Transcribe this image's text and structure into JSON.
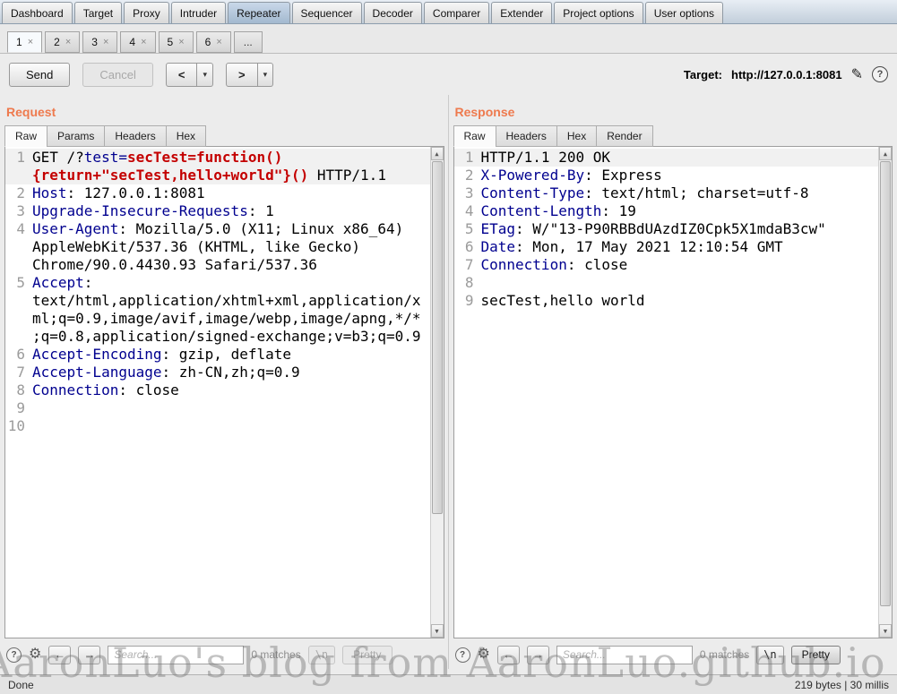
{
  "nav": {
    "tabs": [
      {
        "label": "Dashboard"
      },
      {
        "label": "Target"
      },
      {
        "label": "Proxy"
      },
      {
        "label": "Intruder"
      },
      {
        "label": "Repeater",
        "selected": true
      },
      {
        "label": "Sequencer"
      },
      {
        "label": "Decoder"
      },
      {
        "label": "Comparer"
      },
      {
        "label": "Extender"
      },
      {
        "label": "Project options"
      },
      {
        "label": "User options"
      }
    ]
  },
  "repeater_tabs": {
    "tabs": [
      {
        "label": "1",
        "selected": true
      },
      {
        "label": "2"
      },
      {
        "label": "3"
      },
      {
        "label": "4"
      },
      {
        "label": "5"
      },
      {
        "label": "6"
      }
    ],
    "overflow_label": "..."
  },
  "toolbar": {
    "send_label": "Send",
    "cancel_label": "Cancel",
    "back_label": "<",
    "forward_label": ">",
    "target_label": "Target:",
    "target_value": "http://127.0.0.1:8081"
  },
  "icons": {
    "help": "?",
    "edit": "✎",
    "gear": "⚙",
    "prev": "←",
    "next": "→",
    "up": "▲",
    "down": "▼",
    "close": "×",
    "dropdown": "▾"
  },
  "request_panel": {
    "title": "Request",
    "tabs": [
      {
        "label": "Raw",
        "selected": true
      },
      {
        "label": "Params"
      },
      {
        "label": "Headers"
      },
      {
        "label": "Hex"
      }
    ],
    "lines": [
      {
        "num": "1",
        "highlighted": true,
        "segments": [
          {
            "text": "GET /?",
            "type": "plain"
          },
          {
            "text": "test=",
            "type": "name"
          },
          {
            "text": "secTest=function(){return+\"secTest,hello+world\"}()",
            "type": "value"
          },
          {
            "text": " HTTP/1.1",
            "type": "plain"
          }
        ]
      },
      {
        "num": "2",
        "segments": [
          {
            "text": "Host",
            "type": "name"
          },
          {
            "text": ": 127.0.0.1:8081",
            "type": "plain"
          }
        ]
      },
      {
        "num": "3",
        "segments": [
          {
            "text": "Upgrade-Insecure-Requests",
            "type": "name"
          },
          {
            "text": ": 1",
            "type": "plain"
          }
        ]
      },
      {
        "num": "4",
        "segments": [
          {
            "text": "User-Agent",
            "type": "name"
          },
          {
            "text": ": Mozilla/5.0 (X11; Linux x86_64) AppleWebKit/537.36 (KHTML, like Gecko) Chrome/90.0.4430.93 Safari/537.36",
            "type": "plain"
          }
        ]
      },
      {
        "num": "5",
        "segments": [
          {
            "text": "Accept",
            "type": "name"
          },
          {
            "text": ": text/html,application/xhtml+xml,application/xml;q=0.9,image/avif,image/webp,image/apng,*/*;q=0.8,application/signed-exchange;v=b3;q=0.9",
            "type": "plain"
          }
        ]
      },
      {
        "num": "6",
        "segments": [
          {
            "text": "Accept-Encoding",
            "type": "name"
          },
          {
            "text": ": gzip, deflate",
            "type": "plain"
          }
        ]
      },
      {
        "num": "7",
        "segments": [
          {
            "text": "Accept-Language",
            "type": "name"
          },
          {
            "text": ": zh-CN,zh;q=0.9",
            "type": "plain"
          }
        ]
      },
      {
        "num": "8",
        "segments": [
          {
            "text": "Connection",
            "type": "name"
          },
          {
            "text": ": close",
            "type": "plain"
          }
        ]
      },
      {
        "num": "9",
        "segments": []
      },
      {
        "num": "10",
        "segments": []
      }
    ],
    "search": {
      "placeholder": "Search...",
      "matches_label": "0 matches",
      "newline_label": "\\n",
      "pretty_label": "Pretty"
    }
  },
  "response_panel": {
    "title": "Response",
    "tabs": [
      {
        "label": "Raw",
        "selected": true
      },
      {
        "label": "Headers"
      },
      {
        "label": "Hex"
      },
      {
        "label": "Render"
      }
    ],
    "lines": [
      {
        "num": "1",
        "highlighted": true,
        "segments": [
          {
            "text": "HTTP/1.1 200 OK",
            "type": "plain"
          }
        ]
      },
      {
        "num": "2",
        "segments": [
          {
            "text": "X-Powered-By",
            "type": "name"
          },
          {
            "text": ": Express",
            "type": "plain"
          }
        ]
      },
      {
        "num": "3",
        "segments": [
          {
            "text": "Content-Type",
            "type": "name"
          },
          {
            "text": ": text/html; charset=utf-8",
            "type": "plain"
          }
        ]
      },
      {
        "num": "4",
        "segments": [
          {
            "text": "Content-Length",
            "type": "name"
          },
          {
            "text": ": 19",
            "type": "plain"
          }
        ]
      },
      {
        "num": "5",
        "segments": [
          {
            "text": "ETag",
            "type": "name"
          },
          {
            "text": ": W/\"13-P90RBBdUAzdIZ0Cpk5X1mdaB3cw\"",
            "type": "plain"
          }
        ]
      },
      {
        "num": "6",
        "segments": [
          {
            "text": "Date",
            "type": "name"
          },
          {
            "text": ": Mon, 17 May 2021 12:10:54 GMT",
            "type": "plain"
          }
        ]
      },
      {
        "num": "7",
        "segments": [
          {
            "text": "Connection",
            "type": "name"
          },
          {
            "text": ": close",
            "type": "plain"
          }
        ]
      },
      {
        "num": "8",
        "segments": []
      },
      {
        "num": "9",
        "segments": [
          {
            "text": "secTest,hello world",
            "type": "plain"
          }
        ]
      }
    ],
    "search": {
      "placeholder": "Search...",
      "matches_label": "0 matches",
      "newline_label": "\\n",
      "pretty_label": "Pretty"
    }
  },
  "status_bar": {
    "left": "Done",
    "right": "219 bytes | 30 millis"
  },
  "watermark": "AaronLuo's blog from AaronLuo.github.io"
}
